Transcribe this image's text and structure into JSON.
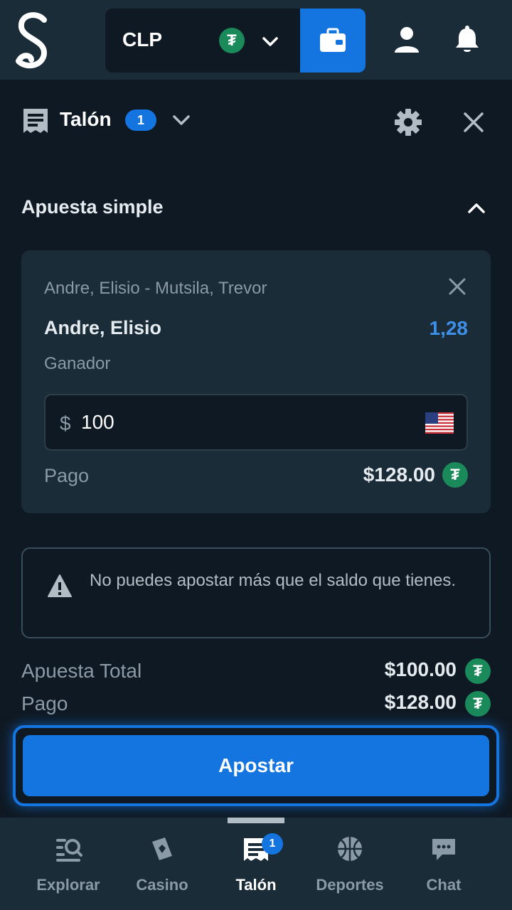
{
  "header": {
    "logo_letter": "S",
    "currency_code": "CLP",
    "currency_icon_glyph": "₮",
    "icons": [
      "logo-icon",
      "tether-icon",
      "chevron-down-icon",
      "wallet-icon",
      "user-icon",
      "bell-icon"
    ]
  },
  "slip": {
    "title": "Talón",
    "count": "1",
    "icons": [
      "bet-slip-icon",
      "chevron-down-icon",
      "gear-icon",
      "close-icon"
    ]
  },
  "section": {
    "title": "Apuesta simple",
    "icon": "chevron-up-icon"
  },
  "bet": {
    "event": "Andre, Elisio - Mutsila, Trevor",
    "selection": "Andre, Elisio",
    "odds": "1,28",
    "market": "Ganador",
    "stake_currency": "$",
    "stake_value": "100",
    "payout_label": "Pago",
    "payout_value": "$128.00",
    "icons": [
      "close-icon",
      "us-flag-icon",
      "tether-icon"
    ]
  },
  "warning": {
    "text": "No puedes apostar más que el saldo que tienes.",
    "icon": "warning-icon"
  },
  "totals": {
    "total_stake_label": "Apuesta Total",
    "total_stake_value": "$100.00",
    "payout_label": "Pago",
    "payout_value": "$128.00"
  },
  "place_bet": {
    "label": "Apostar"
  },
  "nav": {
    "items": [
      {
        "label": "Explorar",
        "icon": "explore-icon"
      },
      {
        "label": "Casino",
        "icon": "casino-icon"
      },
      {
        "label": "Talón",
        "icon": "bet-slip-icon",
        "badge": "1",
        "active": true
      },
      {
        "label": "Deportes",
        "icon": "basketball-icon"
      },
      {
        "label": "Chat",
        "icon": "chat-icon"
      }
    ]
  },
  "colors": {
    "background": "#0f1923",
    "surface": "#1a2c38",
    "accent": "#1475e1",
    "odds": "#3d8fe8",
    "tether": "#1b8a5a",
    "muted_text": "#8a9aa6"
  }
}
